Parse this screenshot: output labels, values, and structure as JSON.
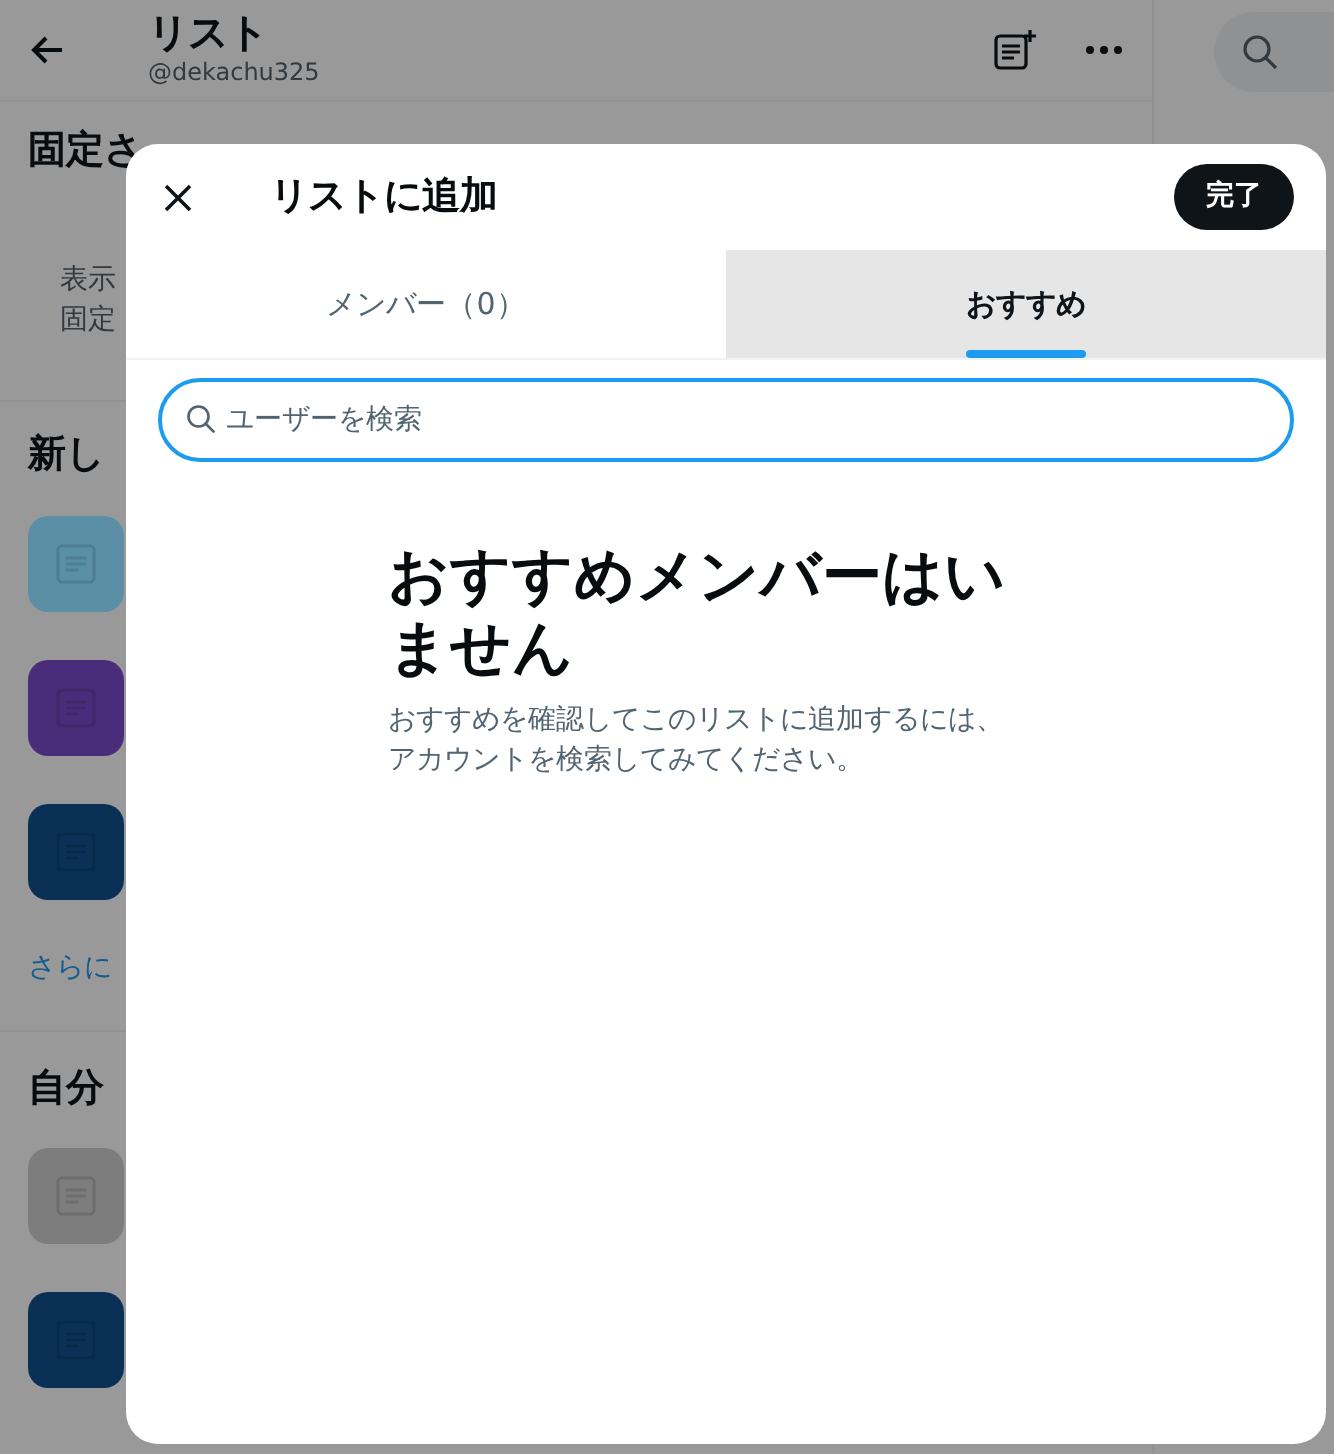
{
  "header": {
    "title": "リスト",
    "handle": "@dekachu325"
  },
  "pinned": {
    "heading": "固定さ",
    "description": [
      "表示",
      "固定"
    ]
  },
  "discover": {
    "heading": "新し",
    "items": [
      {
        "color": "#5b8fa5"
      },
      {
        "color": "#4a2d7a"
      },
      {
        "color": "#0a3055"
      }
    ],
    "more": "さらに"
  },
  "mine": {
    "heading": "自分",
    "items": [
      {
        "color": "#7d7d7d"
      },
      {
        "color": "#0a3055"
      }
    ]
  },
  "modal": {
    "title": "リストに追加",
    "done": "完了",
    "tabs": [
      {
        "label": "メンバー（0）",
        "selected": false
      },
      {
        "label": "おすすめ",
        "selected": true
      }
    ],
    "search": {
      "placeholder": "ユーザーを検索"
    },
    "empty": {
      "title": "おすすめメンバーはいません",
      "body": "おすすめを確認してこのリストに追加するには、アカウントを検索してみてください。"
    }
  }
}
